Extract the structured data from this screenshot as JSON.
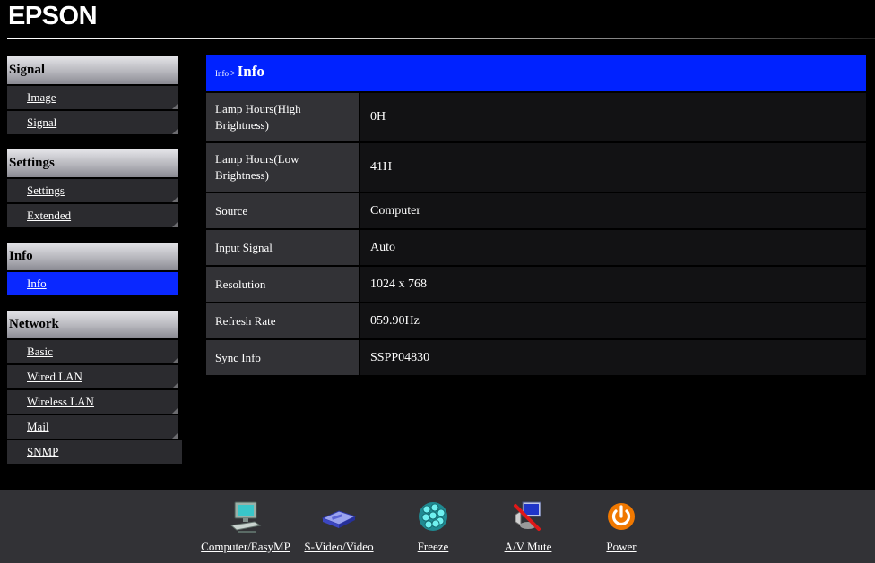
{
  "header": {
    "logo": "EPSON"
  },
  "sidebar": {
    "sections": [
      {
        "title": "Signal",
        "items": [
          {
            "label": "Image"
          },
          {
            "label": "Signal"
          }
        ]
      },
      {
        "title": "Settings",
        "items": [
          {
            "label": "Settings"
          },
          {
            "label": "Extended"
          }
        ]
      },
      {
        "title": "Info",
        "items": [
          {
            "label": "Info",
            "active": true
          }
        ]
      },
      {
        "title": "Network",
        "items": [
          {
            "label": "Basic"
          },
          {
            "label": "Wired LAN"
          },
          {
            "label": "Wireless LAN"
          },
          {
            "label": "Mail"
          },
          {
            "label": "SNMP"
          }
        ]
      }
    ]
  },
  "main": {
    "breadcrumb": "Info",
    "breadcrumb_separator": ">",
    "title": "Info",
    "rows": [
      {
        "label": "Lamp Hours(High Brightness)",
        "value": "0H"
      },
      {
        "label": "Lamp Hours(Low Brightness)",
        "value": "41H"
      },
      {
        "label": "Source",
        "value": "Computer"
      },
      {
        "label": "Input Signal",
        "value": "Auto"
      },
      {
        "label": "Resolution",
        "value": "1024 x 768"
      },
      {
        "label": "Refresh Rate",
        "value": "059.90Hz"
      },
      {
        "label": "Sync Info",
        "value": "SSPP04830"
      }
    ]
  },
  "toolbar": {
    "computer": "Computer/EasyMP",
    "svideo": "S-Video/Video",
    "freeze": "Freeze",
    "av_mute": "A/V Mute",
    "power": "Power"
  },
  "colors": {
    "accent_blue": "#0022ff",
    "active_item": "#0a28ff",
    "label_cell": "#323236",
    "value_cell": "#121214",
    "power_orange": "#f07800"
  },
  "icons": {
    "computer": "computer-icon",
    "svideo": "video-device-icon",
    "freeze": "freeze-icon",
    "av_mute": "av-mute-icon",
    "power": "power-icon"
  }
}
